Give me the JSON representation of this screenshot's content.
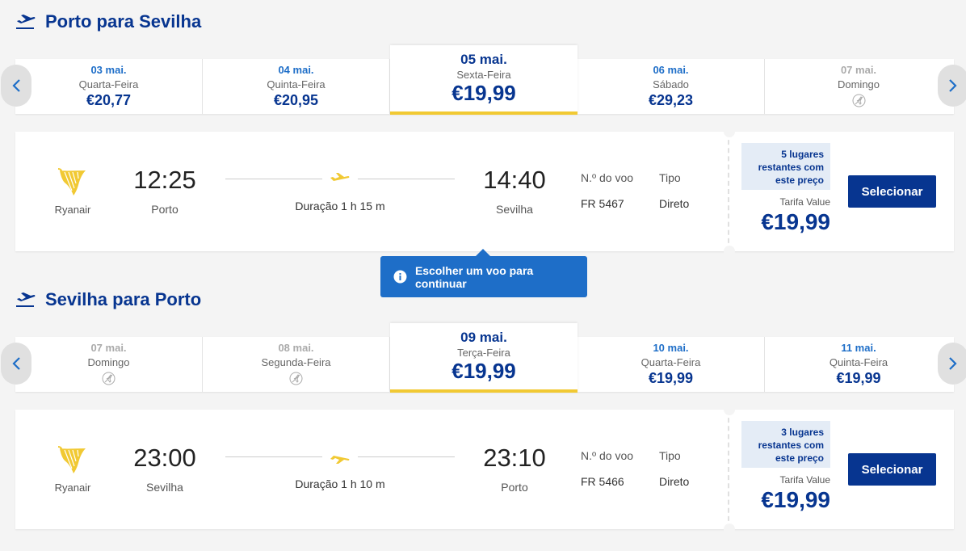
{
  "outbound": {
    "title": "Porto para Sevilha",
    "days": [
      {
        "date": "03 mai.",
        "weekday": "Quarta-Feira",
        "price": "€20,77",
        "available": true,
        "selected": false
      },
      {
        "date": "04 mai.",
        "weekday": "Quinta-Feira",
        "price": "€20,95",
        "available": true,
        "selected": false
      },
      {
        "date": "05 mai.",
        "weekday": "Sexta-Feira",
        "price": "€19,99",
        "available": true,
        "selected": true
      },
      {
        "date": "06 mai.",
        "weekday": "Sábado",
        "price": "€29,23",
        "available": true,
        "selected": false
      },
      {
        "date": "07 mai.",
        "weekday": "Domingo",
        "price": "",
        "available": false,
        "selected": false
      }
    ],
    "flight": {
      "airline": "Ryanair",
      "dep_time": "12:25",
      "dep_city": "Porto",
      "arr_time": "14:40",
      "arr_city": "Sevilha",
      "duration": "Duração 1 h 15 m",
      "flight_no_label": "N.º do voo",
      "flight_no": "FR 5467",
      "type_label": "Tipo",
      "type": "Direto",
      "seats": "5 lugares restantes com este preço",
      "fare_type": "Tarifa Value",
      "fare_price": "€19,99",
      "select_label": "Selecionar"
    }
  },
  "tooltip": {
    "text": "Escolher um voo para continuar",
    "icon": "info-icon"
  },
  "return": {
    "title": "Sevilha para Porto",
    "days": [
      {
        "date": "07 mai.",
        "weekday": "Domingo",
        "price": "",
        "available": false,
        "selected": false
      },
      {
        "date": "08 mai.",
        "weekday": "Segunda-Feira",
        "price": "",
        "available": false,
        "selected": false
      },
      {
        "date": "09 mai.",
        "weekday": "Terça-Feira",
        "price": "€19,99",
        "available": true,
        "selected": true
      },
      {
        "date": "10 mai.",
        "weekday": "Quarta-Feira",
        "price": "€19,99",
        "available": true,
        "selected": false
      },
      {
        "date": "11 mai.",
        "weekday": "Quinta-Feira",
        "price": "€19,99",
        "available": true,
        "selected": false
      }
    ],
    "flight": {
      "airline": "Ryanair",
      "dep_time": "23:00",
      "dep_city": "Sevilha",
      "arr_time": "23:10",
      "arr_city": "Porto",
      "duration": "Duração 1 h 10 m",
      "flight_no_label": "N.º do voo",
      "flight_no": "FR 5466",
      "type_label": "Tipo",
      "type": "Direto",
      "seats": "3 lugares restantes com este preço",
      "fare_type": "Tarifa Value",
      "fare_price": "€19,99",
      "select_label": "Selecionar"
    }
  },
  "colors": {
    "brand": "#073590",
    "accent": "#f1c933",
    "link": "#1e6ec8"
  }
}
